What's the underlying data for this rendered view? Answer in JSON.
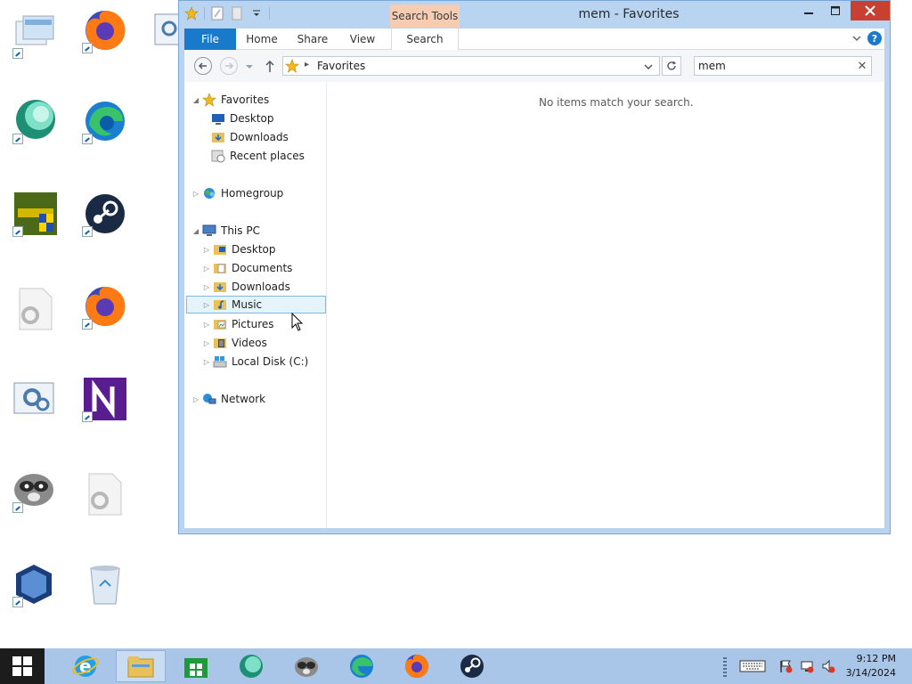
{
  "desktop": {
    "icons": [
      {
        "name": "network-window-icon"
      },
      {
        "name": "firefox-icon"
      },
      {
        "name": "app-bubble-icon"
      },
      {
        "name": "edge-icon"
      },
      {
        "name": "install-tool-icon"
      },
      {
        "name": "steam-icon"
      },
      {
        "name": "settings-file-icon"
      },
      {
        "name": "firefox-icon"
      },
      {
        "name": "control-panel-icon"
      },
      {
        "name": "notepadpp-icon"
      },
      {
        "name": "raccoon-icon"
      },
      {
        "name": "settings-file-icon"
      },
      {
        "name": "virtualbox-icon"
      },
      {
        "name": "recycle-bin-icon"
      }
    ]
  },
  "window": {
    "title": "mem - Favorites",
    "context_tab": "Search Tools",
    "ribbon_tabs": {
      "file": "File",
      "home": "Home",
      "share": "Share",
      "view": "View",
      "search": "Search"
    },
    "address": {
      "path": "Favorites"
    },
    "search": {
      "value": "mem"
    },
    "nav_tree": {
      "favorites": "Favorites",
      "fav_desktop": "Desktop",
      "fav_downloads": "Downloads",
      "fav_recent": "Recent places",
      "homegroup": "Homegroup",
      "this_pc": "This PC",
      "pc_desktop": "Desktop",
      "pc_documents": "Documents",
      "pc_downloads": "Downloads",
      "pc_music": "Music",
      "pc_pictures": "Pictures",
      "pc_videos": "Videos",
      "pc_local_disk": "Local Disk (C:)",
      "network": "Network"
    },
    "empty_message": "No items match your search."
  },
  "taskbar": {
    "clock_time": "9:12 PM",
    "clock_date": "3/14/2024",
    "pinned": [
      "internet-explorer",
      "file-explorer",
      "store",
      "app-bubble",
      "raccoon",
      "edge",
      "firefox",
      "steam"
    ]
  },
  "colors": {
    "accent": "#1979ca",
    "close": "#c8402f",
    "context_tab": "#f6cdb3",
    "taskbar": "#a9c5e7"
  }
}
